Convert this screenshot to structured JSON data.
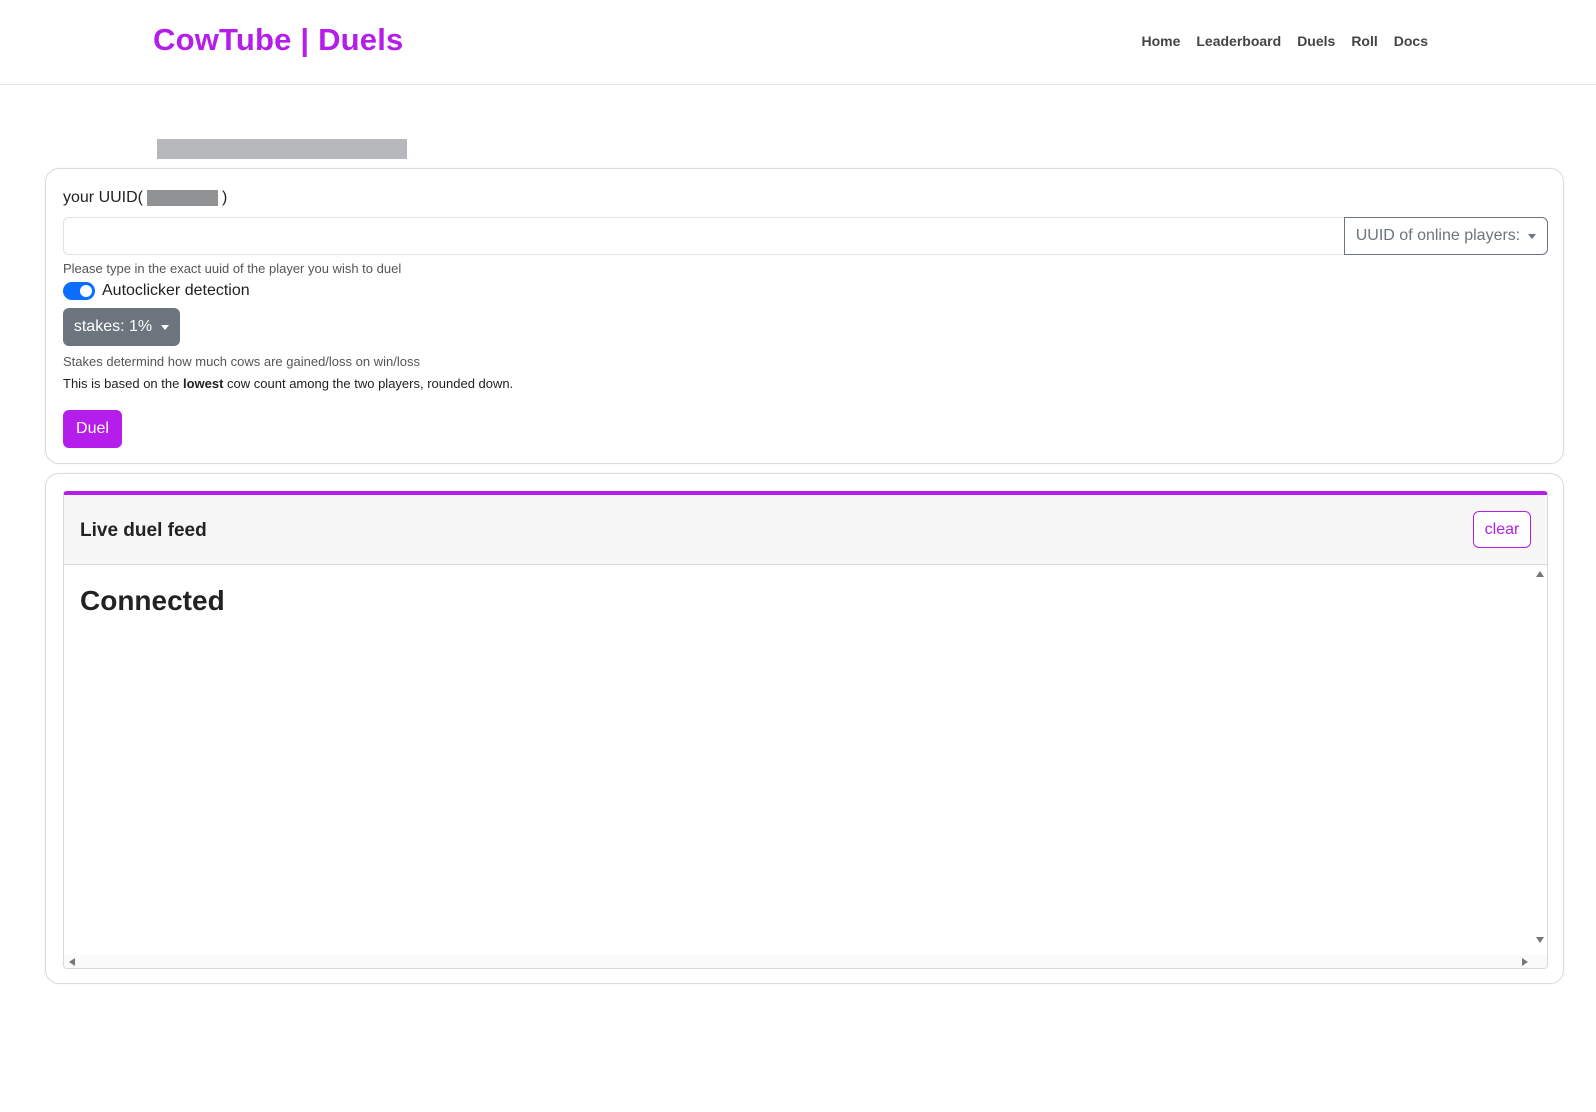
{
  "header": {
    "brand": "CowTube | Duels",
    "nav": [
      {
        "label": "Home"
      },
      {
        "label": "Leaderboard"
      },
      {
        "label": "Duels"
      },
      {
        "label": "Roll"
      },
      {
        "label": "Docs"
      }
    ]
  },
  "form": {
    "uuid_label_prefix": "your UUID(",
    "uuid_label_suffix": ")",
    "uuid_input_value": "",
    "online_players_label": "UUID of online players:",
    "uuid_help": "Please type in the exact uuid of the player you wish to duel",
    "autoclicker_label": "Autoclicker detection",
    "autoclicker_enabled": true,
    "stakes_label": "stakes: 1%",
    "stakes_help": "Stakes determind how much cows are gained/loss on win/loss",
    "based_prefix": "This is based on the ",
    "based_bold": "lowest",
    "based_suffix": " cow count among the two players, rounded down.",
    "duel_label": "Duel"
  },
  "feed": {
    "title": "Live duel feed",
    "clear_label": "clear",
    "message": "Connected"
  },
  "colors": {
    "accent": "#b51eea",
    "toggle": "#0d6efd",
    "secondary": "#6c757d"
  },
  "icons": {
    "dropdown_caret": "chevron-down-icon",
    "scroll_up": "arrow-up-icon",
    "scroll_down": "arrow-down-icon",
    "scroll_left": "arrow-left-icon",
    "scroll_right": "arrow-right-icon"
  }
}
